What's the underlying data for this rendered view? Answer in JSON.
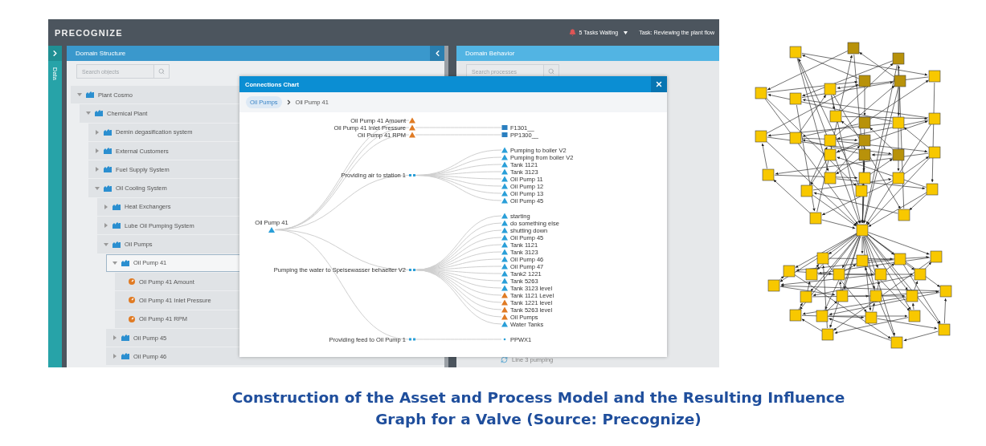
{
  "app": {
    "logo": "PRECOGNIZE",
    "tasks": "5 Tasks Waiting",
    "task": "Task: Reviewing the plant flow",
    "side_tab": "Data",
    "domain_structure": {
      "title": "Domain Structure",
      "search": {
        "placeholder": "Search objects"
      },
      "tree": [
        {
          "label": "Plant Cosmo",
          "kind": "group",
          "expanded": true,
          "selected": false,
          "children": [
            {
              "label": "Chemical Plant",
              "kind": "group",
              "expanded": true,
              "selected": false,
              "children": [
                {
                  "label": "Demin degasification system",
                  "kind": "group",
                  "expanded": false,
                  "selected": false
                },
                {
                  "label": "External Customers",
                  "kind": "group",
                  "expanded": false,
                  "selected": false
                },
                {
                  "label": "Fuel Supply System",
                  "kind": "group",
                  "expanded": false,
                  "selected": false
                },
                {
                  "label": "Oil Cooling System",
                  "kind": "group",
                  "expanded": true,
                  "selected": false,
                  "children": [
                    {
                      "label": "Heat Exchangers",
                      "kind": "group",
                      "expanded": false,
                      "selected": false
                    },
                    {
                      "label": "Lube Oil Pumping System",
                      "kind": "group",
                      "expanded": false,
                      "selected": false
                    },
                    {
                      "label": "Oil Pumps",
                      "kind": "group",
                      "expanded": true,
                      "selected": false,
                      "children": [
                        {
                          "label": "Oil Pump 41",
                          "kind": "group",
                          "expanded": true,
                          "selected": true,
                          "children": [
                            {
                              "label": "Oil Pump 41 Amount",
                              "kind": "sensor",
                              "selected": false
                            },
                            {
                              "label": "Oil Pump 41 Inlet Pressure",
                              "kind": "sensor",
                              "selected": false
                            },
                            {
                              "label": "Oil Pump 41 RPM",
                              "kind": "sensor",
                              "selected": false
                            }
                          ]
                        },
                        {
                          "label": "Oil Pump 45",
                          "kind": "group",
                          "expanded": false,
                          "selected": false
                        },
                        {
                          "label": "Oil Pump 46",
                          "kind": "group",
                          "expanded": false,
                          "selected": false
                        }
                      ]
                    }
                  ]
                }
              ]
            }
          ]
        }
      ]
    },
    "domain_behavior": {
      "title": "Domain Behavior",
      "search": {
        "placeholder": "Search processes"
      },
      "items": [
        {
          "label": "Line 3 pumping"
        }
      ]
    },
    "modal": {
      "title": "Connections Chart",
      "breadcrumb": [
        {
          "label": "Oil Pumps",
          "kind": "link"
        },
        {
          "label": "Oil Pump 41",
          "kind": "current"
        }
      ],
      "diagram": {
        "root": {
          "label": "Oil Pump 41",
          "kind": "triangle",
          "color": "#2a9fd8",
          "children": [
            {
              "label": "Oil Pump 41 Amount",
              "kind": "triangle",
              "color": "#e07b24"
            },
            {
              "label": "Oil Pump 41 Inlet Pressure",
              "kind": "triangle",
              "color": "#e07b24",
              "children": [
                {
                  "label": "F1301__",
                  "kind": "square",
                  "color": "#2a7fc0"
                }
              ]
            },
            {
              "label": "Oil Pump 41 RPM",
              "kind": "triangle",
              "color": "#e07b24",
              "children": [
                {
                  "label": "PP1300__",
                  "kind": "square",
                  "color": "#2a7fc0"
                }
              ]
            },
            {
              "label": "Providing air to station 1",
              "kind": "dots",
              "color": "#2a9fd8",
              "children": [
                {
                  "label": "Pumping to boiler V2",
                  "kind": "triangle",
                  "color": "#2a9fd8"
                },
                {
                  "label": "Pumping from boiler V2",
                  "kind": "triangle",
                  "color": "#2a9fd8"
                },
                {
                  "label": "Tank 1121",
                  "kind": "triangle",
                  "color": "#2a9fd8"
                },
                {
                  "label": "Tank 3123",
                  "kind": "triangle",
                  "color": "#2a9fd8"
                },
                {
                  "label": "Oil Pump 11",
                  "kind": "triangle",
                  "color": "#2a9fd8"
                },
                {
                  "label": "Oil Pump 12",
                  "kind": "triangle",
                  "color": "#2a9fd8"
                },
                {
                  "label": "Oil Pump 13",
                  "kind": "triangle",
                  "color": "#2a9fd8"
                },
                {
                  "label": "Oil Pump 45",
                  "kind": "triangle",
                  "color": "#2a9fd8"
                }
              ]
            },
            {
              "label": "Pumping the water to Speisewasser behaelter V2",
              "kind": "dots",
              "color": "#2a9fd8",
              "children": [
                {
                  "label": "starting",
                  "kind": "triangle",
                  "color": "#2a9fd8"
                },
                {
                  "label": "do something else",
                  "kind": "triangle",
                  "color": "#2a9fd8"
                },
                {
                  "label": "shutting down",
                  "kind": "triangle",
                  "color": "#2a9fd8"
                },
                {
                  "label": "Oil Pump 45",
                  "kind": "triangle",
                  "color": "#2a9fd8"
                },
                {
                  "label": "Tank 1121",
                  "kind": "triangle",
                  "color": "#2a9fd8"
                },
                {
                  "label": "Tank 3123",
                  "kind": "triangle",
                  "color": "#2a9fd8"
                },
                {
                  "label": "Oil Pump 46",
                  "kind": "triangle",
                  "color": "#2a9fd8"
                },
                {
                  "label": "Oil Pump 47",
                  "kind": "triangle",
                  "color": "#2a9fd8"
                },
                {
                  "label": "Tank2 1221",
                  "kind": "triangle",
                  "color": "#2a9fd8"
                },
                {
                  "label": "Tank 5263",
                  "kind": "triangle",
                  "color": "#2a9fd8"
                },
                {
                  "label": "Tank 3123 level",
                  "kind": "triangle",
                  "color": "#2a9fd8"
                },
                {
                  "label": "Tank 1121 Level",
                  "kind": "triangle",
                  "color": "#e07b24"
                },
                {
                  "label": "Tank 1221 level",
                  "kind": "triangle",
                  "color": "#e07b24"
                },
                {
                  "label": "Tank 5263 level",
                  "kind": "triangle",
                  "color": "#e07b24"
                },
                {
                  "label": "Oil Pumps",
                  "kind": "triangle",
                  "color": "#e07b24"
                },
                {
                  "label": "Water Tanks",
                  "kind": "triangle",
                  "color": "#2a9fd8"
                }
              ]
            },
            {
              "label": "Providing feed to Oil Pump 1",
              "kind": "dots",
              "color": "#2a9fd8",
              "children": [
                {
                  "label": "PPWX1",
                  "kind": "dot",
                  "color": "#2a9fd8"
                }
              ]
            }
          ]
        }
      }
    }
  },
  "caption": "Construction of the Asset and Process Model and the Resulting Influence Graph for a Valve (Source: Precognize)"
}
